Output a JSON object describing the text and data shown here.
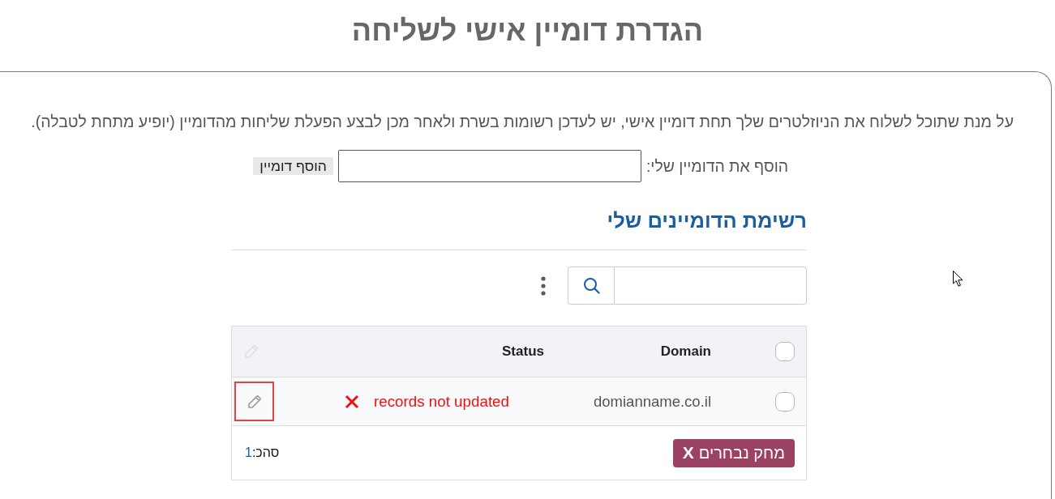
{
  "page_title": "הגדרת דומיין אישי לשליחה",
  "intro": "על מנת שתוכל לשלוח את הניוזלטרים שלך תחת דומיין אישי, יש לעדכן רשומות בשרת ולאחר מכן לבצע הפעלת שליחות מהדומיין (יופיע מתחת לטבלה).",
  "add_domain": {
    "label": "הוסף את הדומיין שלי:",
    "button": "הוסף דומיין"
  },
  "domain_list": {
    "title": "רשימת הדומיינים שלי",
    "table": {
      "select_all": {
        "checked": false
      },
      "edit_column": {
        "disabled": true
      },
      "columns": [
        "Domain",
        "Status"
      ],
      "rows": [
        {
          "selected": false,
          "domain": "domianname.co.il",
          "status": {
            "kind": "error",
            "text": "records not updated"
          },
          "edit": {
            "highlighted": true
          }
        }
      ]
    },
    "footer": {
      "delete_button": {
        "icon": "X",
        "label": "מחק נבחרים"
      },
      "total_label": "סהכ:",
      "total_count": "1"
    }
  }
}
